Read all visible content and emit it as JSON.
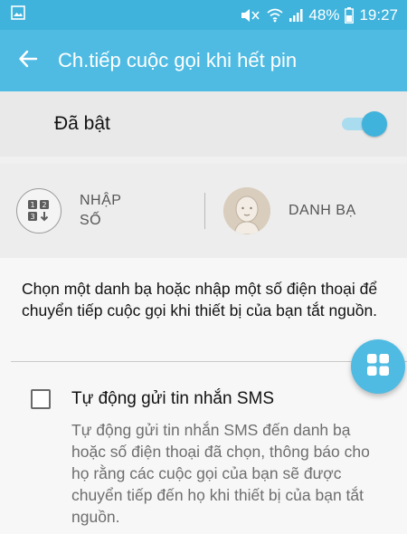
{
  "status_bar": {
    "battery": "48%",
    "time": "19:27",
    "icons": [
      "image-icon",
      "mute-icon",
      "wifi-icon",
      "signal-icon",
      "battery-icon"
    ]
  },
  "app_bar": {
    "title": "Ch.tiếp cuộc gọi khi hết pin",
    "back_icon": "arrow-back-icon"
  },
  "toggle": {
    "label": "Đã bật",
    "state": "on"
  },
  "source": {
    "manual_label_line1": "NHẬP",
    "manual_label_line2": "SỐ",
    "contacts_label": "DANH BẠ"
  },
  "description": "Chọn một danh bạ hoặc nhập một số điện thoại để chuyển tiếp cuộc gọi khi thiết bị của bạn tắt nguồn.",
  "sms_option": {
    "title": "Tự động gửi tin nhắn SMS",
    "description": "Tự động gửi tin nhắn SMS đến danh bạ hoặc số điện thoại đã chọn, thông báo cho họ rằng các cuộc gọi của bạn sẽ được chuyển tiếp đến họ khi thiết bị của bạn tắt nguồn.",
    "checked": false
  },
  "colors": {
    "accent": "#4fbbe2",
    "status_bar": "#3fb3dc",
    "switch_thumb": "#3fb3dc",
    "switch_track": "#a9dcef"
  }
}
